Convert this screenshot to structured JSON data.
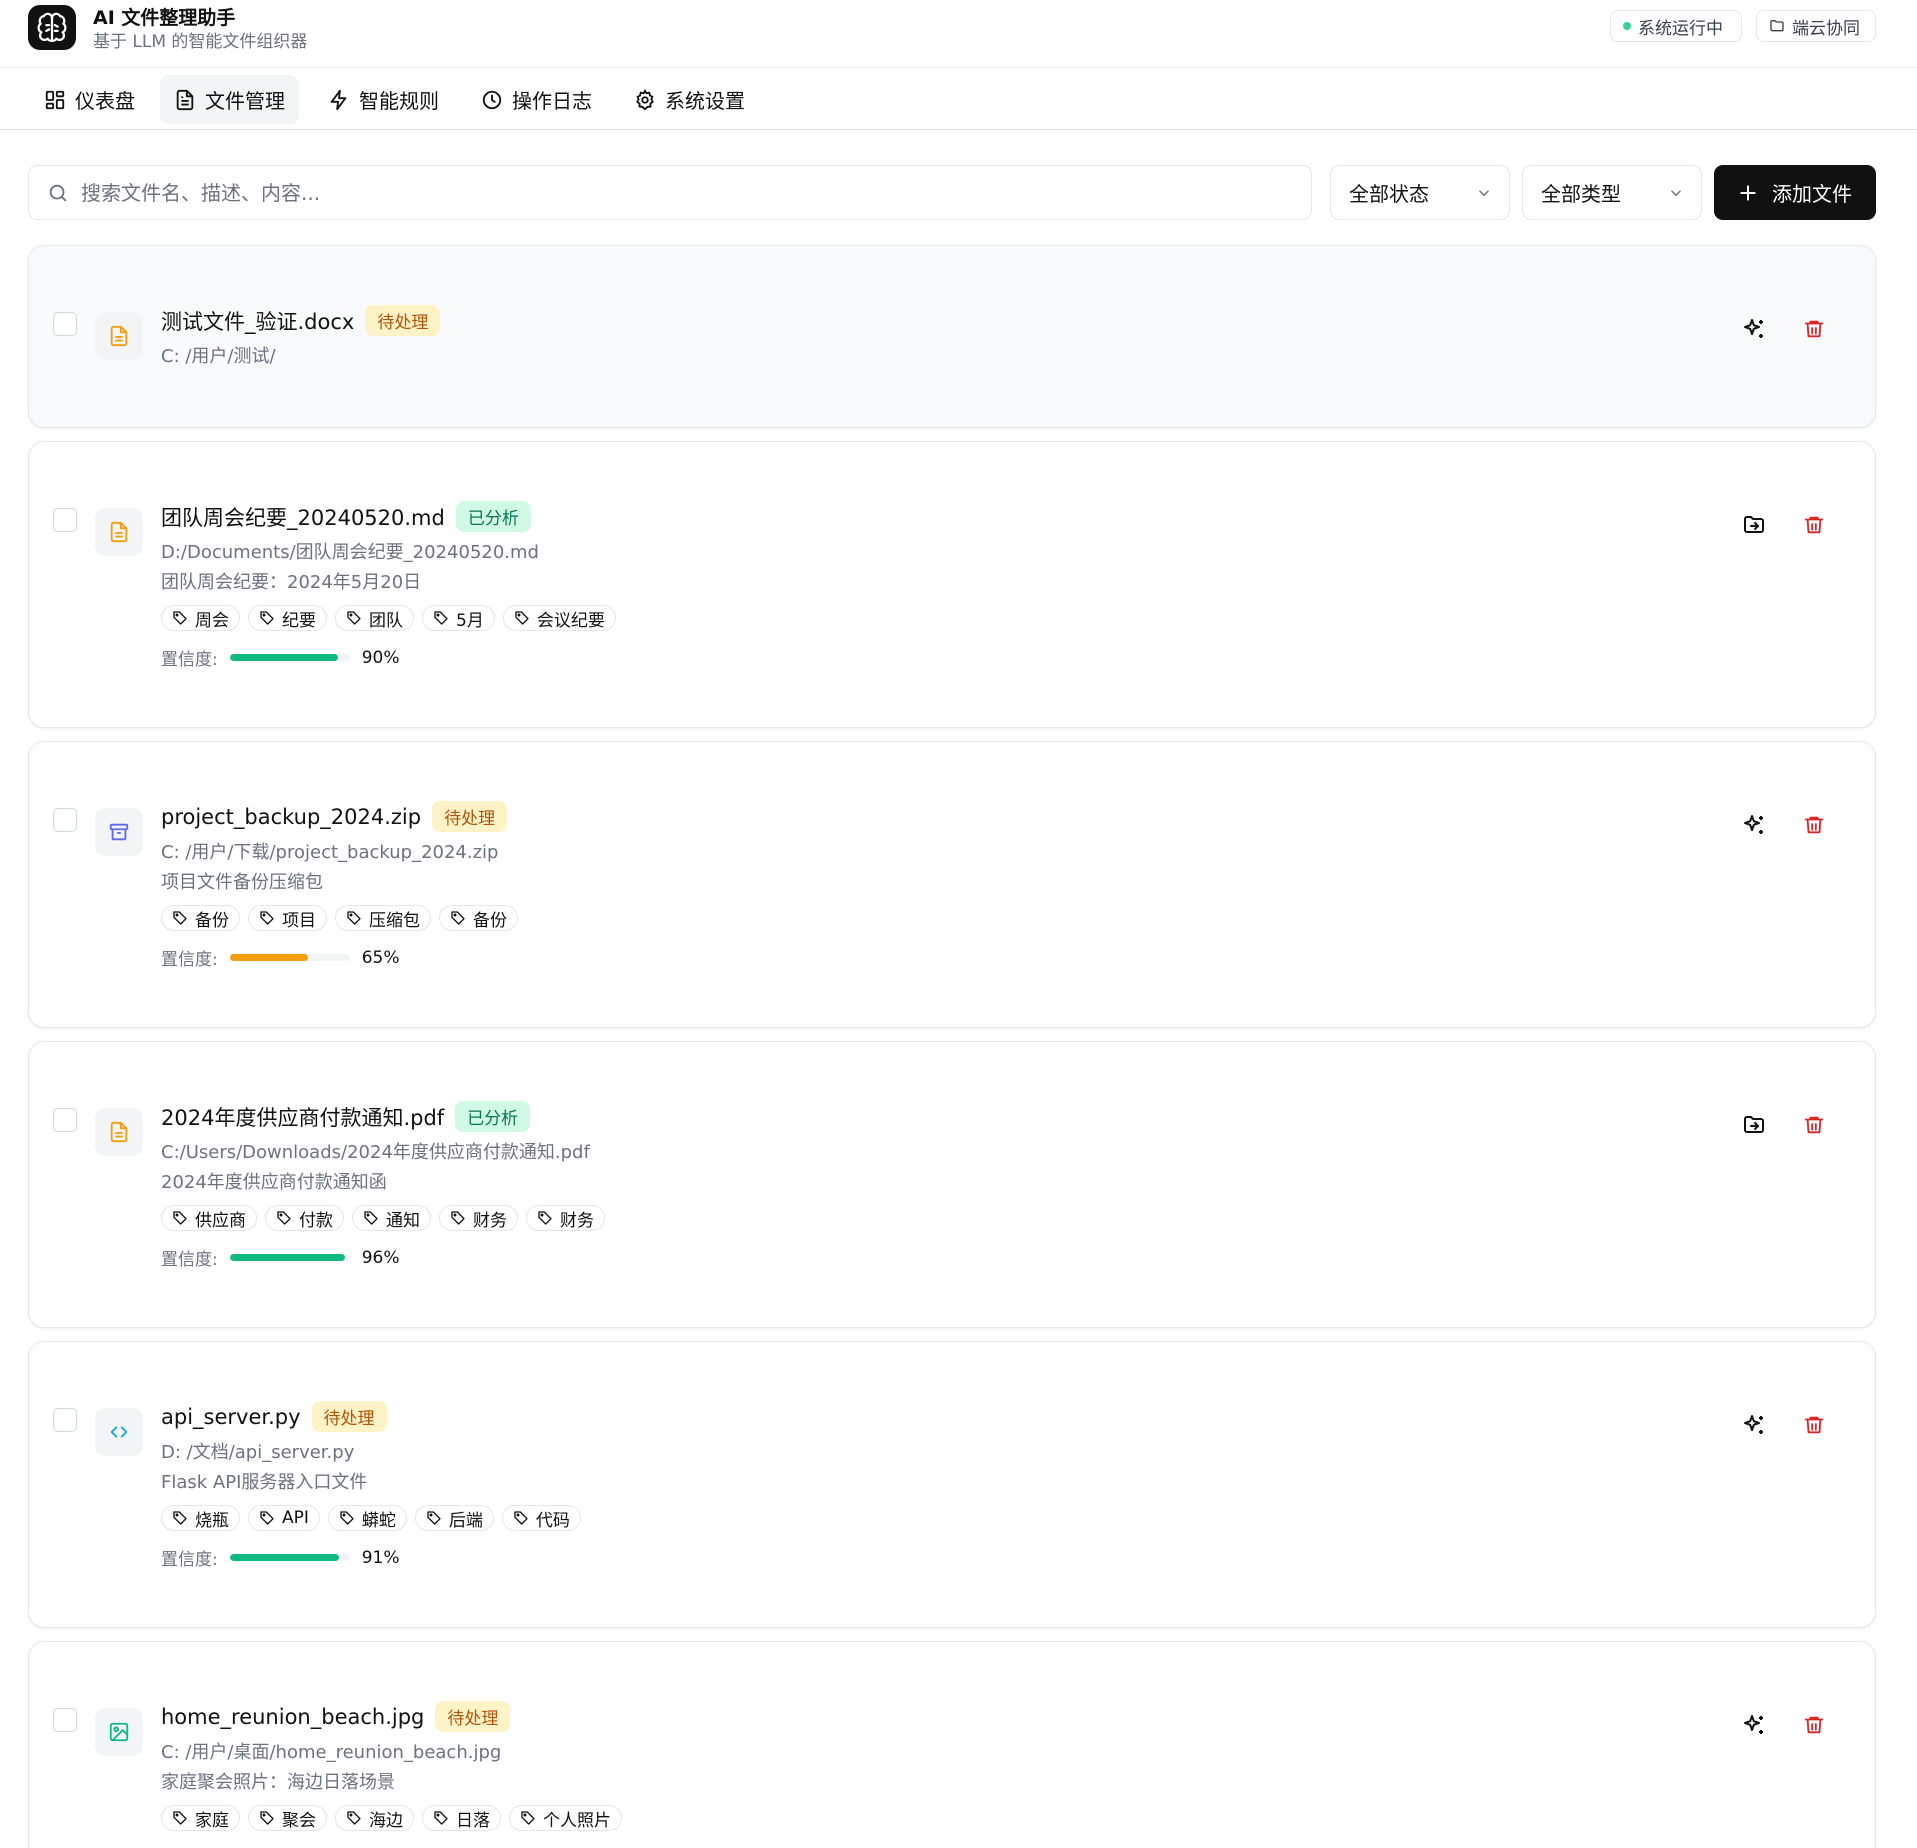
{
  "app": {
    "title": "AI 文件整理助手",
    "subtitle": "基于 LLM 的智能文件组织器"
  },
  "status": {
    "running": "系统运行中",
    "sync": "端云协同"
  },
  "nav": {
    "tabs": [
      {
        "label": "仪表盘"
      },
      {
        "label": "文件管理"
      },
      {
        "label": "智能规则"
      },
      {
        "label": "操作日志"
      },
      {
        "label": "系统设置"
      }
    ]
  },
  "toolbar": {
    "search_placeholder": "搜索文件名、描述、内容...",
    "status_filter": "全部状态",
    "type_filter": "全部类型",
    "add_label": "添加文件"
  },
  "labels": {
    "confidence": "置信度:"
  },
  "colors": {
    "pending_bg": "#fef3c7",
    "pending_fg": "#b45309",
    "done_bg": "#d1fae5",
    "done_fg": "#047857",
    "conf_high": "#10b981",
    "conf_mid": "#f59e0b"
  },
  "files": [
    {
      "name": "测试文件_验证.docx",
      "status": "待处理",
      "path": "C:  /用户/测试/",
      "icon": "document-icon"
    },
    {
      "name": "团队周会纪要_20240520.md",
      "status": "已分析",
      "path": "D:/Documents/团队周会纪要_20240520.md",
      "desc": "团队周会纪要：2024年5月20日",
      "tags": [
        "周会",
        "纪要",
        "团队",
        "5月",
        "会议纪要"
      ],
      "confidence": "90%",
      "icon": "document-icon"
    },
    {
      "name": "project_backup_2024.zip",
      "status": "待处理",
      "path": "C:  /用户/下载/project_backup_2024.zip",
      "desc": "项目文件备份压缩包",
      "tags": [
        "备份",
        "项目",
        "压缩包",
        "备份"
      ],
      "confidence": "65%",
      "icon": "archive-icon"
    },
    {
      "name": "2024年度供应商付款通知.pdf",
      "status": "已分析",
      "path": "C:/Users/Downloads/2024年度供应商付款通知.pdf",
      "desc": "2024年度供应商付款通知函",
      "tags": [
        "供应商",
        "付款",
        "通知",
        "财务",
        "财务"
      ],
      "confidence": "96%",
      "icon": "document-icon"
    },
    {
      "name": "api_server.py",
      "status": "待处理",
      "path": "D:  /文档/api_server.py",
      "desc": "Flask API服务器入口文件",
      "tags": [
        "烧瓶",
        "API",
        "蟒蛇",
        "后端",
        "代码"
      ],
      "confidence": "91%",
      "icon": "code-icon"
    },
    {
      "name": "home_reunion_beach.jpg",
      "status": "待处理",
      "path": "C:  /用户/桌面/home_reunion_beach.jpg",
      "desc": "家庭聚会照片：海边日落场景",
      "tags": [
        "家庭",
        "聚会",
        "海边",
        "日落",
        "个人照片"
      ],
      "icon": "image-icon"
    }
  ]
}
